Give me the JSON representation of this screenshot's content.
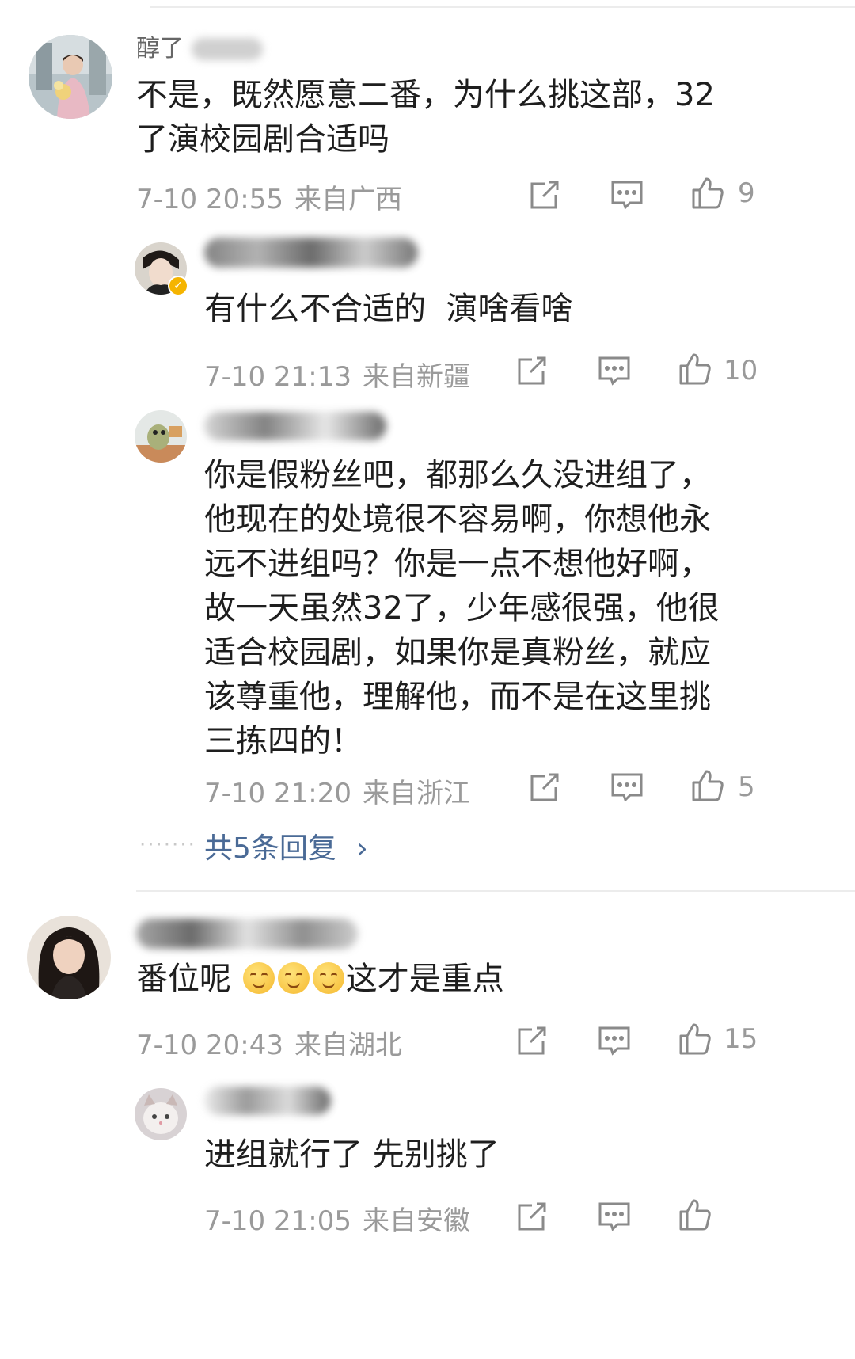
{
  "comments": [
    {
      "username": "醇了",
      "text": "不是，既然愿意二番，为什么挑这部，32了演校园剧合适吗",
      "time": "7-10 20:55",
      "location": "来自广西",
      "likes": "9",
      "replies": [
        {
          "username": "",
          "text": "有什么不合适的  演啥看啥",
          "time": "7-10 21:13",
          "location": "来自新疆",
          "likes": "10"
        },
        {
          "username": "",
          "text": "你是假粉丝吧，都那么久没进组了，他现在的处境很不容易啊，你想他永远不进组吗？你是一点不想他好啊，故一天虽然32了，少年感很强，他很适合校园剧，如果你是真粉丝，就应该尊重他，理解他，而不是在这里挑三拣四的！",
          "time": "7-10 21:20",
          "location": "来自浙江",
          "likes": "5"
        }
      ],
      "more_replies": "共5条回复"
    },
    {
      "username": "",
      "text_before": "番位呢",
      "text_after": "这才是重点",
      "emoji_count": 3,
      "time": "7-10 20:43",
      "location": "来自湖北",
      "likes": "15",
      "replies": [
        {
          "username": "",
          "text": "进组就行了 先别挑了",
          "time": "7-10 21:05",
          "location": "来自安徽",
          "likes": ""
        }
      ]
    }
  ],
  "icons": {
    "forward": "share-edit-icon",
    "comment": "comment-icon",
    "like": "thumbs-up-icon",
    "more": "chevron-right-icon"
  },
  "colors": {
    "link": "#4a6a96",
    "meta": "#9a9a9a",
    "text": "#1e1e1e"
  }
}
